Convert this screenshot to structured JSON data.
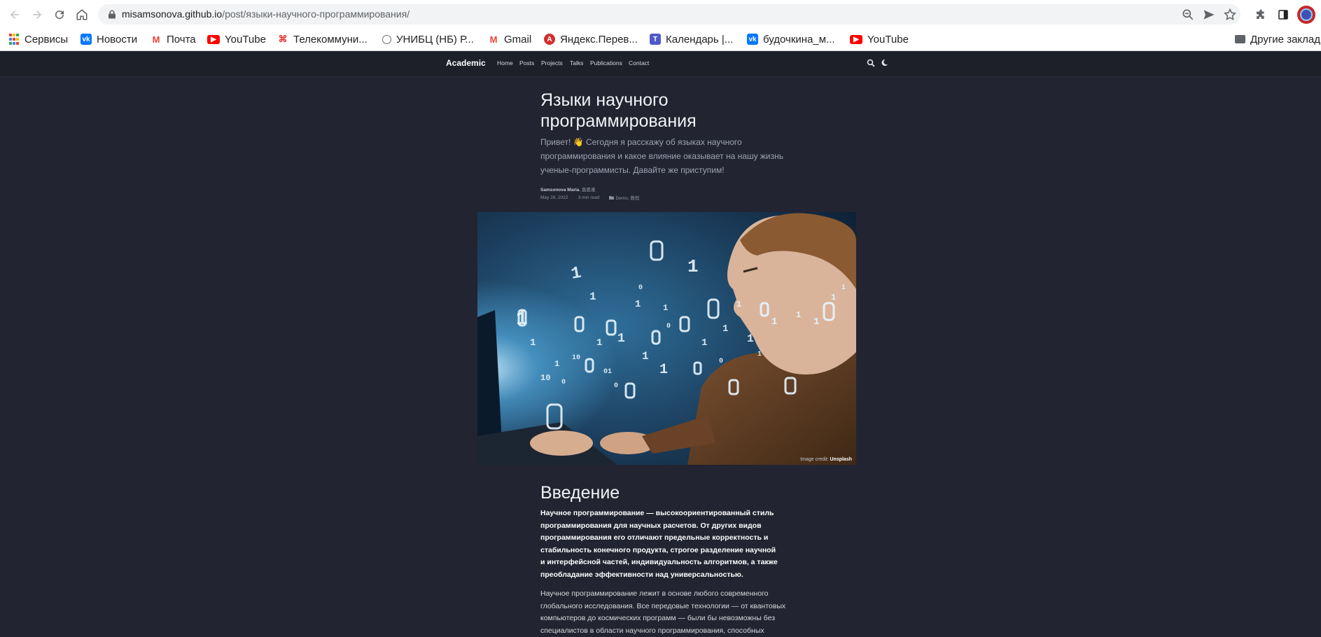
{
  "browser": {
    "url_host": "misamsonova.github.io",
    "url_path": "/post/языки-научного-программирования/",
    "bookmarks": [
      {
        "label": "Сервисы",
        "icon": "apps-grid-icon",
        "color": "#4285f4"
      },
      {
        "label": "Новости",
        "icon": "vk-icon",
        "color": "#0077ff"
      },
      {
        "label": "Почта",
        "icon": "mail-ru-icon",
        "color": "#ea4335"
      },
      {
        "label": "YouTube",
        "icon": "youtube-icon",
        "color": "#ff0000"
      },
      {
        "label": "Телекоммуни...",
        "icon": "telecom-icon",
        "color": "#e53935"
      },
      {
        "label": "УНИБЦ (НБ) Р...",
        "icon": "library-icon",
        "color": "#6d6d6d"
      },
      {
        "label": "Gmail",
        "icon": "gmail-icon",
        "color": "#ea4335"
      },
      {
        "label": "Яндекс.Перев...",
        "icon": "yandex-translate-icon",
        "color": "#d32f2f"
      },
      {
        "label": "Календарь |...",
        "icon": "teams-icon",
        "color": "#5059c9"
      },
      {
        "label": "будочкина_м...",
        "icon": "vk-icon",
        "color": "#0077ff"
      },
      {
        "label": "YouTube",
        "icon": "youtube-icon",
        "color": "#ff0000"
      }
    ],
    "other_bookmarks": "Другие заклад"
  },
  "site": {
    "brand": "Academic",
    "nav": [
      "Home",
      "Posts",
      "Projects",
      "Talks",
      "Publications",
      "Contact"
    ]
  },
  "article": {
    "title": "Языки научного программирования",
    "summary": "Привет! 👋 Сегодня я расскажу об языках научного программирования и какое влияние оказывает на нашу жизнь ученые-программисты. Давайте же приступим!",
    "authors": "Samsonova Maria",
    "authors_extra": ", 吳恩達",
    "date": "May 26, 2022",
    "read_time": "3 min read",
    "categories": "Demo, 教程",
    "image_credit_prefix": "Image credit: ",
    "image_credit_source": "Unsplash",
    "intro_heading": "Введение",
    "intro_bold": "Научное программирование — высокоориентированный стиль программирования для научных расчетов. От других видов программирования его отличают предельные корректность и стабильность конечного продукта, строгое разделение научной и интерфейсной частей, индивидуальность алгоритмов, а также преобладание эффективности над универсальностью.",
    "intro_text": "Научное программирование лежит в основе любого современного глобального исследования. Все передовые технологии — от квантовых компьютеров до космических программ — были бы невозможны без специалистов в области научного программирования, способных"
  },
  "colors": {
    "page_bg": "#222431",
    "nav_bg": "#1d1f29",
    "accent": "#4a88f0"
  }
}
